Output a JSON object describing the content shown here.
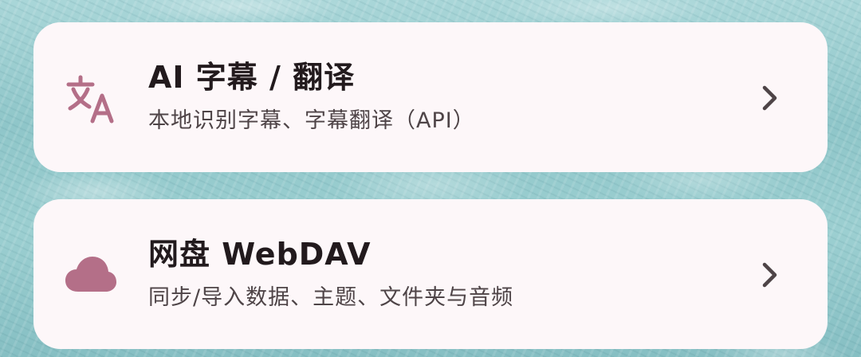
{
  "colors": {
    "accent": "#b46f88",
    "card_background": "#fdf7f9",
    "title_text": "#221a1d",
    "subtitle_text": "#4e4447",
    "chevron": "#4e4447"
  },
  "items": [
    {
      "icon": "translate-icon",
      "title": "AI 字幕 / 翻译",
      "subtitle": "本地识别字幕、字幕翻译（API）"
    },
    {
      "icon": "cloud-icon",
      "title": "网盘 WebDAV",
      "subtitle": "同步/导入数据、主题、文件夹与音频"
    }
  ]
}
